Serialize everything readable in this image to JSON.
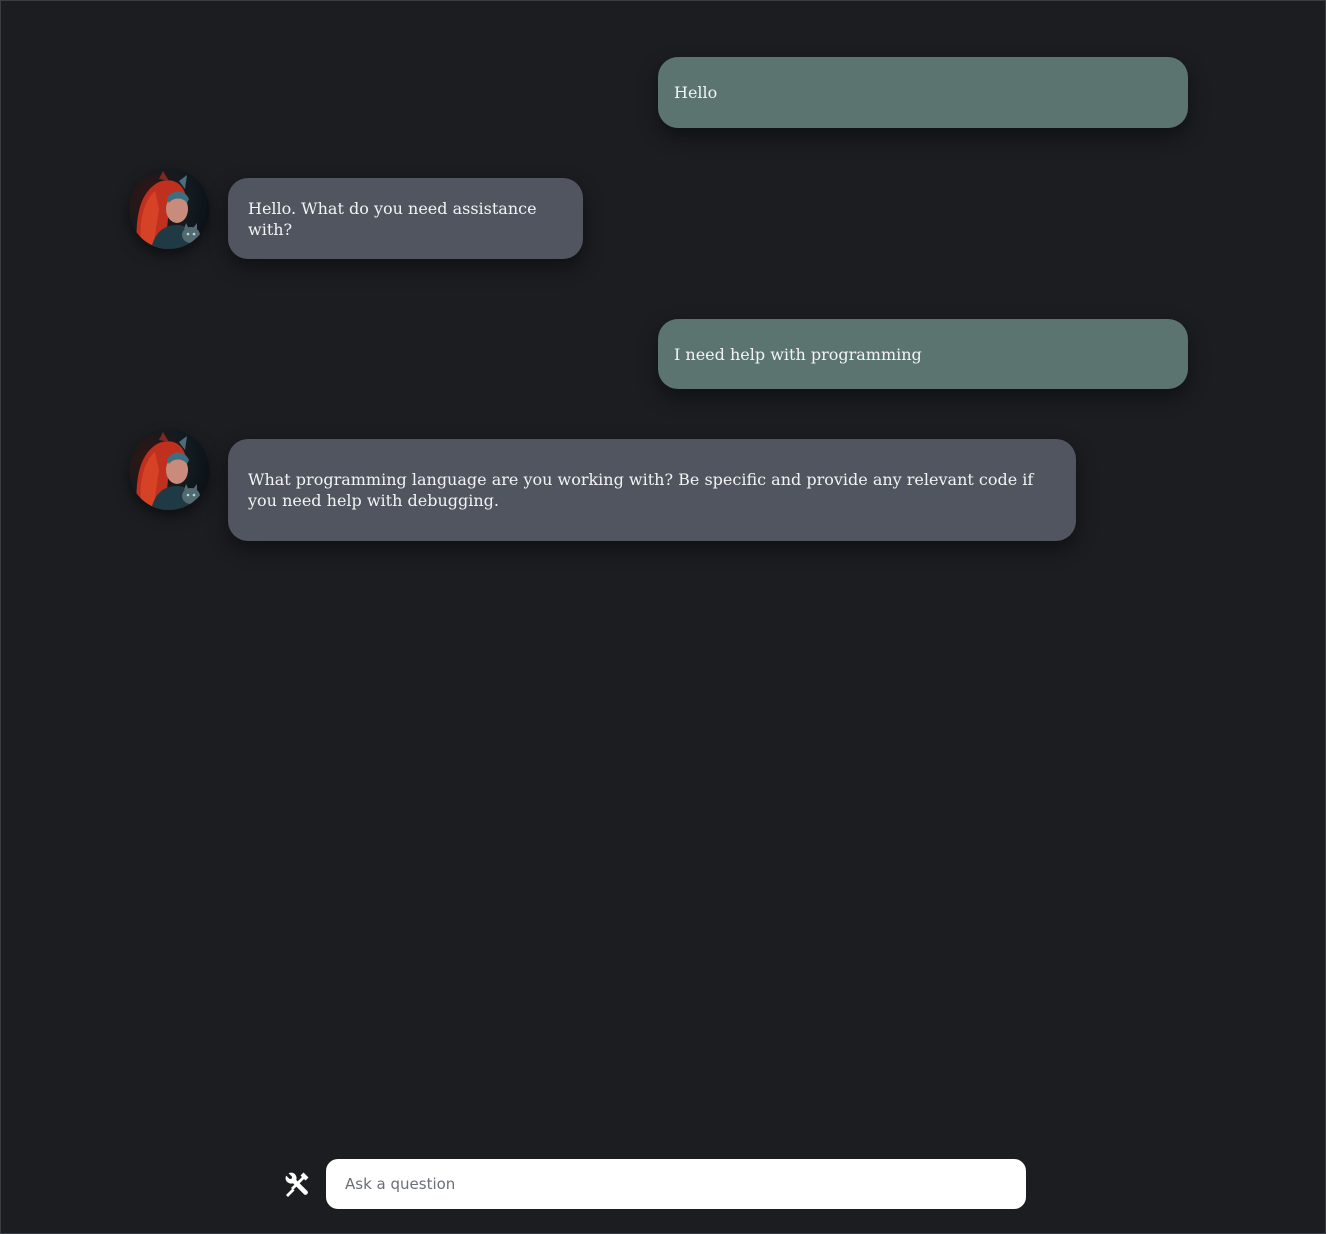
{
  "conversation": {
    "messages": [
      {
        "role": "user",
        "text": "Hello"
      },
      {
        "role": "assistant",
        "text": "Hello. What do you need assistance with?"
      },
      {
        "role": "user",
        "text": "I need help with programming"
      },
      {
        "role": "assistant",
        "text": "What programming language are you working with? Be specific and provide any relevant code if you need help with debugging."
      }
    ]
  },
  "composer": {
    "placeholder": "Ask a question",
    "value": "",
    "tools_icon": "tools-icon"
  },
  "colors": {
    "background": "#1b1d21",
    "user_bubble": "#5b746f",
    "assistant_bubble": "#50555f"
  }
}
